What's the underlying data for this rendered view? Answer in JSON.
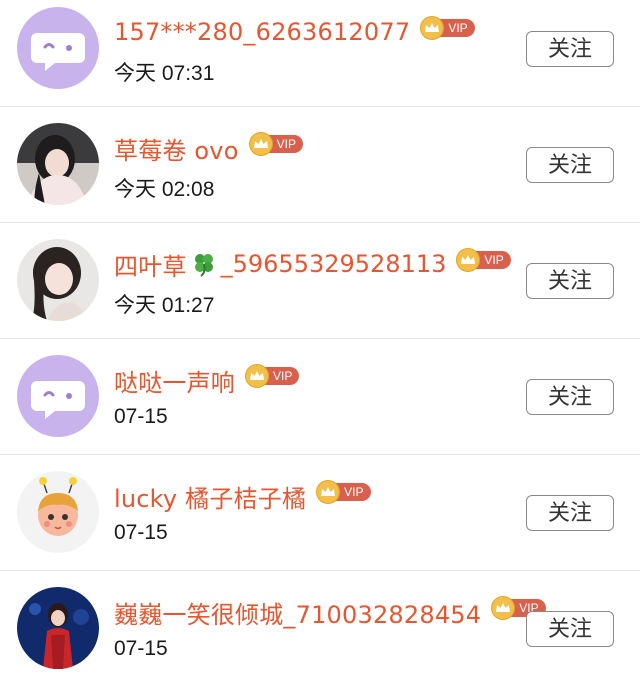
{
  "follow_label": "关注",
  "accent_color": "#e8552f",
  "vip_label": "VIP",
  "users": [
    {
      "name": "157***280_6263612077",
      "name_suffix": "",
      "time": "今天 07:31",
      "avatar": "default-chat-avatar",
      "vip": true
    },
    {
      "name": "草莓卷 ovo",
      "name_suffix": "",
      "time": "今天 02:08",
      "avatar": "photo-avatar",
      "vip": true
    },
    {
      "name": "四叶草",
      "name_suffix": "_59655329528113",
      "time": "今天 01:27",
      "avatar": "photo-avatar",
      "vip": true,
      "emoji": "four-leaf-clover-icon"
    },
    {
      "name": "哒哒一声响",
      "name_suffix": "",
      "time": "07-15",
      "avatar": "default-chat-avatar",
      "vip": true
    },
    {
      "name": "lucky 橘子桔子橘",
      "name_suffix": "",
      "time": "07-15",
      "avatar": "cartoon-avatar",
      "vip": true
    },
    {
      "name": "巍巍一笑很倾城_710032828454",
      "name_suffix": "",
      "time": "07-15",
      "avatar": "photo-avatar",
      "vip": true
    }
  ]
}
